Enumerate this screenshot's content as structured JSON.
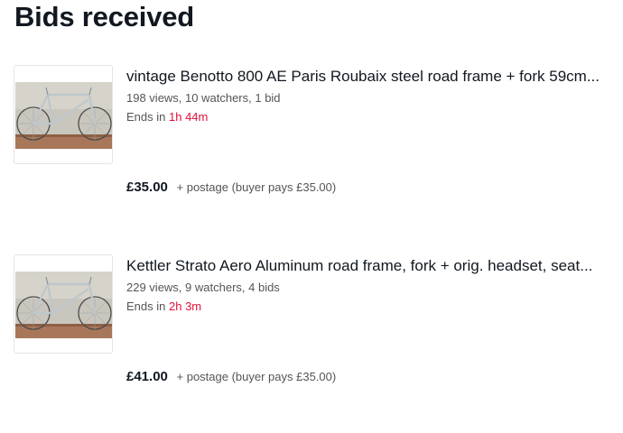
{
  "page": {
    "title": "Bids received"
  },
  "listings": [
    {
      "title": "vintage Benotto 800 AE Paris Roubaix steel road frame + fork 59cm...",
      "stats": "198 views, 10 watchers, 1 bid",
      "ends_prefix": "Ends in",
      "ends_time": "1h 44m",
      "price": "£35.00",
      "postage": "+ postage (buyer pays £35.00)"
    },
    {
      "title": "Kettler Strato Aero Aluminum road frame, fork + orig. headset, seat...",
      "stats": "229 views, 9 watchers, 4 bids",
      "ends_prefix": "Ends in",
      "ends_time": "2h 3m",
      "price": "£41.00",
      "postage": "+ postage (buyer pays £35.00)"
    }
  ],
  "colors": {
    "ends_time": "#e0103a",
    "title": "#111820",
    "meta": "#555555"
  }
}
